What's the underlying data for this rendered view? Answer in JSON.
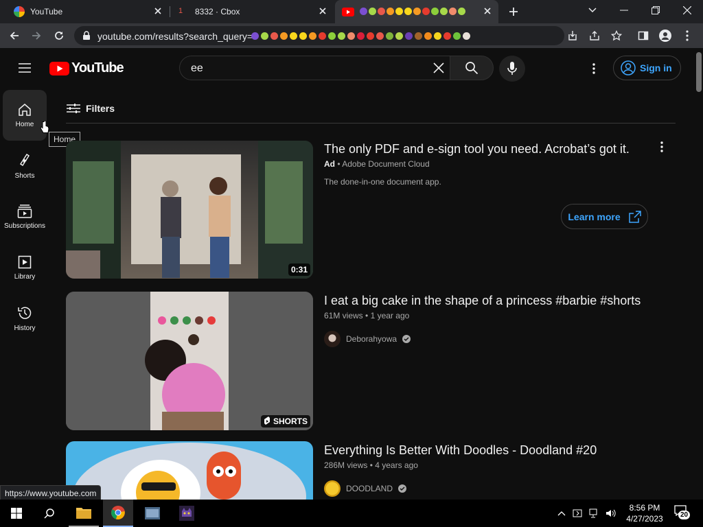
{
  "browser": {
    "tabs": [
      {
        "title": "YouTube",
        "icon": "google-icon"
      },
      {
        "title": "8332 · Cbox",
        "icon": "cbox-icon"
      },
      {
        "title": "",
        "icon": "youtube-icon"
      }
    ],
    "new_tab": "+",
    "url": "youtube.com/results?search_query=",
    "emoji_colors": [
      "#7b4fd1",
      "#a7d94a",
      "#e8584b",
      "#f59a23",
      "#f9d71c",
      "#f9d71c",
      "#f59a23",
      "#e63b2e",
      "#8ccf3b",
      "#a7d94a",
      "#f08c6c",
      "#d91f3a",
      "#e63b2e",
      "#e8584b",
      "#7fb33b",
      "#b5d64b",
      "#6a3fb3",
      "#a0632b",
      "#f28b1c",
      "#f5d51e",
      "#e63b2e",
      "#6ec23b",
      "#e8e0d8"
    ],
    "status_url": "https://www.youtube.com"
  },
  "youtube": {
    "logo_text": "YouTube",
    "search_query": "ee",
    "sign_in": "Sign in",
    "filters": "Filters",
    "tooltip": "Home",
    "guide": [
      {
        "label": "Home",
        "icon": "home-icon"
      },
      {
        "label": "Shorts",
        "icon": "shorts-icon"
      },
      {
        "label": "Subscriptions",
        "icon": "subscriptions-icon"
      },
      {
        "label": "Library",
        "icon": "library-icon"
      },
      {
        "label": "History",
        "icon": "history-icon"
      }
    ],
    "results": [
      {
        "title": "The only PDF and e-sign tool you need. Acrobat’s got it.",
        "ad_label": "Ad",
        "advertiser": "Adobe Document Cloud",
        "description": "The done-in-one document app.",
        "duration": "0:31",
        "cta": "Learn more"
      },
      {
        "title": "I eat a big cake in the shape of a princess #barbie #shorts",
        "views": "61M views",
        "age": "1 year ago",
        "channel": "Deborahyowa",
        "badge": "SHORTS"
      },
      {
        "title": "Everything Is Better With Doodles - Doodland #20",
        "views": "286M views",
        "age": "4 years ago",
        "channel": "DOODLAND"
      }
    ]
  },
  "taskbar": {
    "time": "8:56 PM",
    "date": "4/27/2023",
    "notifications": "20"
  },
  "colors": {
    "bg": "#0f0f0f",
    "accent": "#3ea6ff",
    "youtube_red": "#ff0000"
  }
}
